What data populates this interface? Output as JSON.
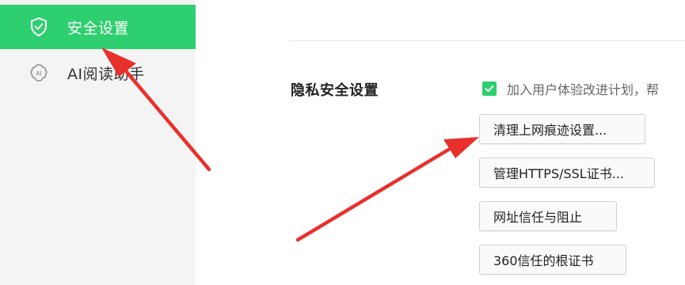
{
  "sidebar": {
    "items": [
      {
        "label": "安全设置",
        "icon": "shield-check-icon",
        "active": true
      },
      {
        "label": "AI阅读助手",
        "icon": "ai-brain-icon",
        "active": false
      }
    ]
  },
  "privacy": {
    "title": "隐私安全设置",
    "checkbox": {
      "label": "加入用户体验改进计划，帮",
      "checked": true
    },
    "buttons": [
      {
        "label": "清理上网痕迹设置..."
      },
      {
        "label": "管理HTTPS/SSL证书..."
      },
      {
        "label": "网址信任与阻止"
      },
      {
        "label": "360信任的根证书"
      }
    ]
  },
  "colors": {
    "accent": "#2ecf6e",
    "annotation_arrow": "#e8302c"
  }
}
